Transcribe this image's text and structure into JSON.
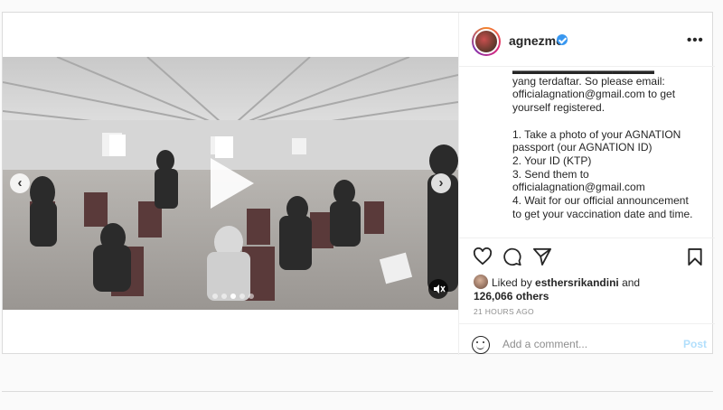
{
  "post": {
    "username": "agnezmo",
    "more_label": "•••",
    "caption_lines": [
      "yang terdaftar. So please email:",
      "officialagnation@gmail.com to get",
      "yourself registered.",
      "",
      "1. Take a photo of your AGNATION",
      "passport (our AGNATION ID)",
      "2. Your ID (KTP)",
      "3. Send them to",
      "officialagnation@gmail.com",
      "4. Wait for our official announcement",
      "to get your vaccination date and time."
    ],
    "likes": {
      "prefix": "Liked by ",
      "liker": "esthersrikandini",
      "conjunction": " and",
      "others": "126,066 others"
    },
    "timestamp": "21 HOURS AGO",
    "comment": {
      "placeholder": "Add a comment...",
      "post_label": "Post"
    },
    "media": {
      "nav_prev": "‹",
      "nav_next": "›",
      "slide_count": 5,
      "active_slide": 3
    }
  },
  "icons": [
    "play-icon",
    "chevron-left-icon",
    "chevron-right-icon",
    "mute-icon",
    "verified-icon",
    "more-icon",
    "heart-icon",
    "comment-icon",
    "share-icon",
    "bookmark-icon",
    "emoji-icon"
  ],
  "colors": {
    "verified": "#3897f0",
    "post_button": "#b2dffc",
    "muted_text": "#8e8e8e",
    "border": "#dbdbdb"
  }
}
